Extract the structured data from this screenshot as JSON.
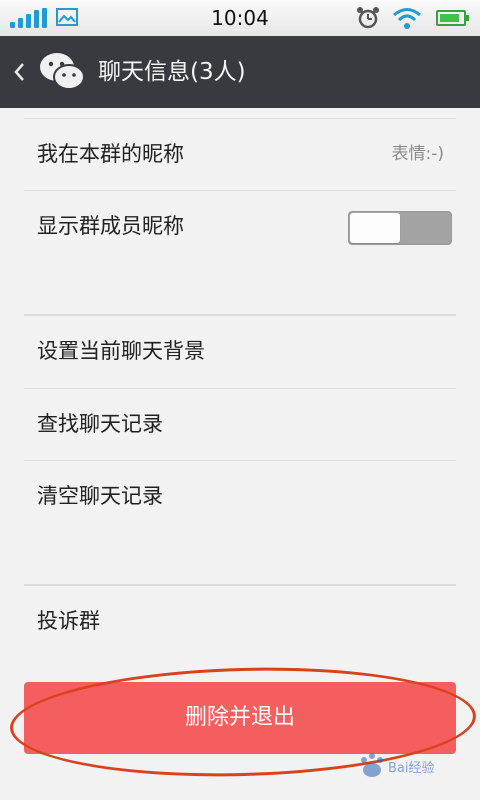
{
  "status_bar": {
    "time": "10:04",
    "battery_level": 0.85,
    "icons": [
      "signal-icon",
      "image-notification-icon",
      "alarm-icon",
      "wifi-icon",
      "battery-icon"
    ]
  },
  "header": {
    "back_icon": "chevron-left-icon",
    "logo": "wechat-logo-icon",
    "title": "聊天信息(3人)",
    "bg_color": "#393a3f"
  },
  "settings": {
    "group_nickname": {
      "label": "我在本群的昵称",
      "value": "表情:-)"
    },
    "show_member_nicknames": {
      "label": "显示群成员昵称",
      "enabled": false
    },
    "chat_background": {
      "label": "设置当前聊天背景"
    },
    "search_history": {
      "label": "查找聊天记录"
    },
    "clear_history": {
      "label": "清空聊天记录"
    },
    "report_group": {
      "label": "投诉群"
    }
  },
  "delete_button": {
    "label": "删除并退出",
    "color": "#f55e5e"
  },
  "annotation": {
    "ellipse_color": "#d8421e"
  }
}
